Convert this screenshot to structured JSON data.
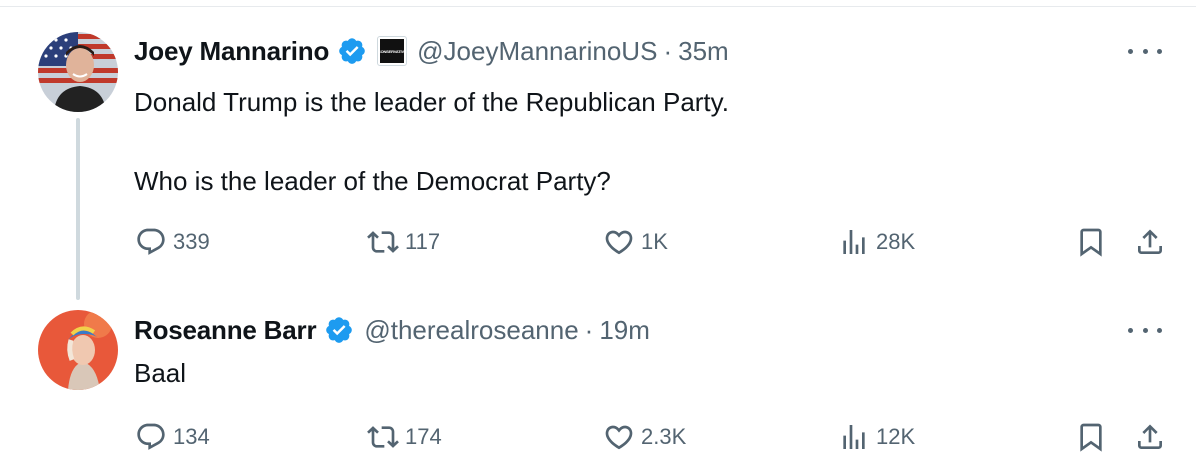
{
  "tweets": [
    {
      "name": "Joey Mannarino",
      "affiliation_badge": "CONSERVATIVE",
      "handle": "@JoeyMannarinoUS",
      "separator": "·",
      "time": "35m",
      "text_lines": [
        "Donald Trump is the leader of the Republican Party.",
        "Who is the leader of the Democrat Party?"
      ],
      "replies": "339",
      "reposts": "117",
      "likes": "1K",
      "views": "28K"
    },
    {
      "name": "Roseanne Barr",
      "handle": "@therealroseanne",
      "separator": "·",
      "time": "19m",
      "text_lines": [
        "Baal"
      ],
      "replies": "134",
      "reposts": "174",
      "likes": "2.3K",
      "views": "12K"
    }
  ],
  "colors": {
    "verified_blue": "#1d9bf0",
    "secondary_text": "#536471",
    "thread_line": "#cfd9de"
  },
  "icons": [
    "verified-badge-icon",
    "more-icon",
    "reply-icon",
    "repost-icon",
    "like-icon",
    "views-icon",
    "bookmark-icon",
    "share-icon"
  ]
}
